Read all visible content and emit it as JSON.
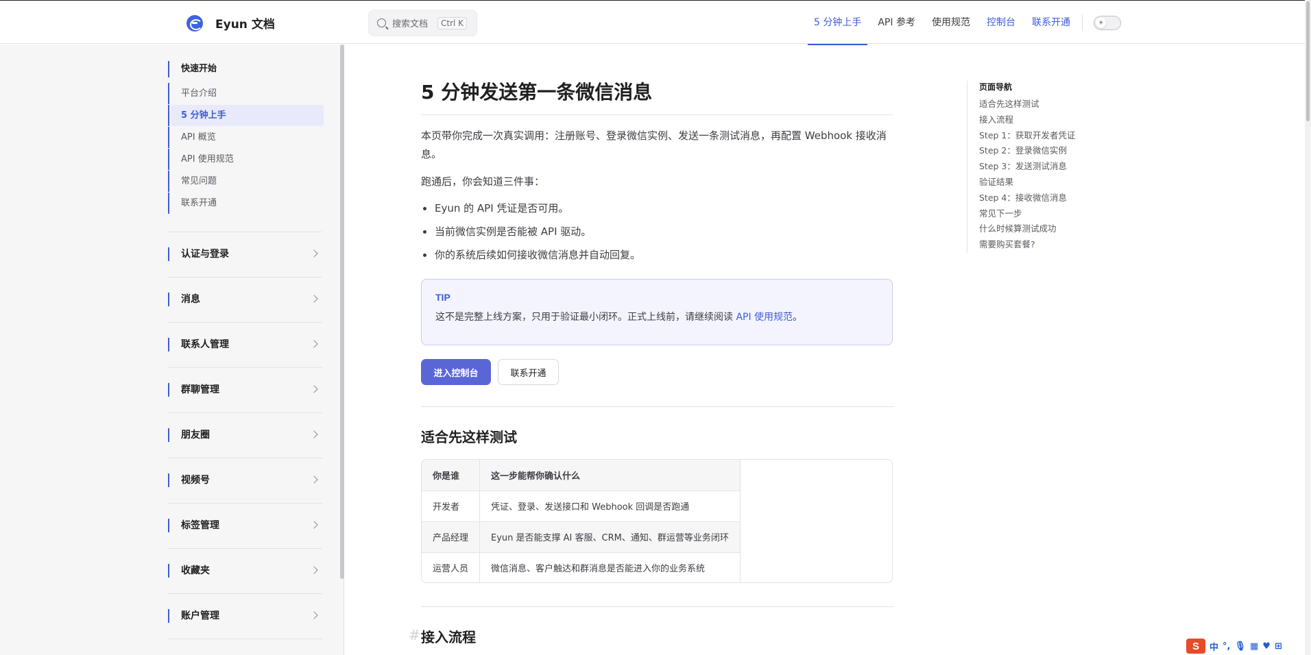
{
  "brand": {
    "title": "Eyun 文档"
  },
  "search": {
    "placeholder": "搜索文档",
    "shortcut": "Ctrl K"
  },
  "nav": {
    "items": [
      {
        "label": "5 分钟上手"
      },
      {
        "label": "API 参考"
      },
      {
        "label": "使用规范"
      },
      {
        "label": "控制台"
      },
      {
        "label": "联系开通"
      }
    ]
  },
  "sidebar": {
    "heading": "快速开始",
    "items": [
      {
        "label": "平台介绍"
      },
      {
        "label": "5 分钟上手"
      },
      {
        "label": "API 概览"
      },
      {
        "label": "API 使用规范"
      },
      {
        "label": "常见问题"
      },
      {
        "label": "联系开通"
      }
    ],
    "sections": [
      {
        "label": "认证与登录"
      },
      {
        "label": "消息"
      },
      {
        "label": "联系人管理"
      },
      {
        "label": "群聊管理"
      },
      {
        "label": "朋友圈"
      },
      {
        "label": "视频号"
      },
      {
        "label": "标签管理"
      },
      {
        "label": "收藏夹"
      },
      {
        "label": "账户管理"
      }
    ]
  },
  "main": {
    "title": "5 分钟发送第一条微信消息",
    "intro": "本页带你完成一次真实调用：注册账号、登录微信实例、发送一条测试消息，再配置 Webhook 接收消息。",
    "lead": "跑通后，你会知道三件事：",
    "bullets": [
      "Eyun 的 API 凭证是否可用。",
      "当前微信实例是否能被 API 驱动。",
      "你的系统后续如何接收微信消息并自动回复。"
    ],
    "tip": {
      "title": "TIP",
      "text": "这不是完整上线方案，只用于验证最小闭环。正式上线前，请继续阅读 ",
      "link": "API 使用规范",
      "suffix": "。"
    },
    "buttons": {
      "primary": "进入控制台",
      "secondary": "联系开通"
    },
    "section1": "适合先这样测试",
    "table": {
      "headers": [
        "你是谁",
        "这一步能帮你确认什么"
      ],
      "rows": [
        [
          "开发者",
          "凭证、登录、发送接口和 Webhook 回调是否跑通"
        ],
        [
          "产品经理",
          "Eyun 是否能支撑 AI 客服、CRM、通知、群运营等业务闭环"
        ],
        [
          "运营人员",
          "微信消息、客户触达和群消息是否能进入你的业务系统"
        ]
      ]
    },
    "section2": "接入流程"
  },
  "outline": {
    "title": "页面导航",
    "items": [
      "适合先这样测试",
      "接入流程",
      "Step 1：获取开发者凭证",
      "Step 2：登录微信实例",
      "Step 3：发送测试消息",
      "验证结果",
      "Step 4：接收微信消息",
      "常见下一步",
      "什么时候算测试成功",
      "需要购买套餐?"
    ]
  },
  "ime": {
    "logo": "S",
    "mode": "中"
  },
  "colors": {
    "accent": "#3f5bd6",
    "primary_button": "#5b66d6",
    "tip_bg": "#f4f4fe"
  }
}
